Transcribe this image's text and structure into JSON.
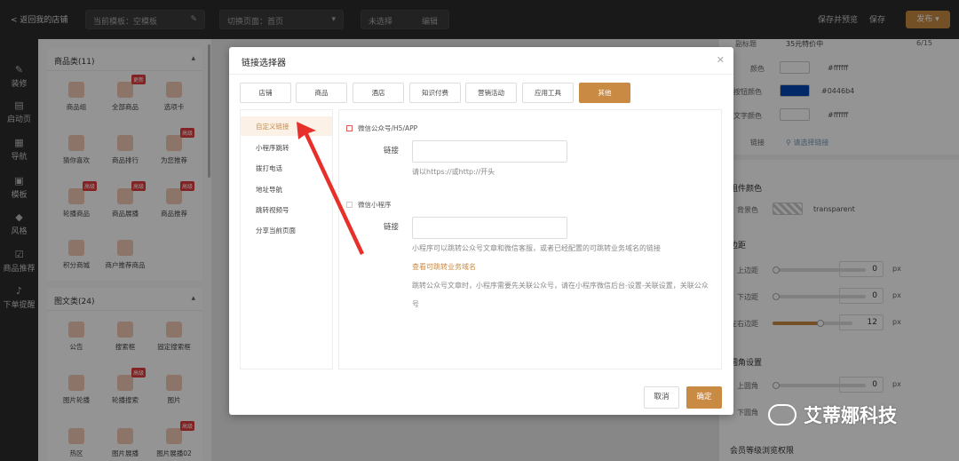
{
  "topbar": {
    "back": "< 返回我的店铺",
    "template": "当前模板：空模板",
    "page": "切换页面：首页",
    "unselected": "未选择",
    "edit": "编辑",
    "save_preview": "保存并预览",
    "save": "保存",
    "publish": "发布"
  },
  "leftnav": [
    {
      "label": "装修",
      "icon": "paint-icon"
    },
    {
      "label": "启动页",
      "icon": "page-icon"
    },
    {
      "label": "导航",
      "icon": "grid-icon"
    },
    {
      "label": "模板",
      "icon": "template-icon"
    },
    {
      "label": "风格",
      "icon": "style-icon"
    },
    {
      "label": "商品推荐",
      "icon": "recommend-icon"
    },
    {
      "label": "下单提醒",
      "icon": "bell-icon"
    }
  ],
  "components": {
    "group1_title": "商品类(11)",
    "group1": [
      "商品组",
      "全部商品",
      "选项卡",
      "猜你喜欢",
      "商品排行",
      "为您推荐",
      "轮播商品",
      "商品展播",
      "商品推荐",
      "积分商城",
      "商户推荐商品"
    ],
    "group2_title": "图文类(24)",
    "group2": [
      "公告",
      "搜索框",
      "固定搜索框",
      "图片轮播",
      "轮播搜索",
      "图片",
      "热区",
      "图片展播",
      "图片展播02"
    ],
    "badge": "高级",
    "badge_new": "更新"
  },
  "right_panel": {
    "subtitle_label": "副标题",
    "subtitle_value": "35元特价中",
    "subtitle_count": "6/15",
    "color_label": "颜色",
    "color_value": "#ffffff",
    "btn_color_label": "按钮颜色",
    "btn_color_value": "#0446b4",
    "text_color_label": "文字颜色",
    "text_color_value": "#ffffff",
    "link_label": "链接",
    "link_placeholder": "请选择链接",
    "bg_section": "组件颜色",
    "bg_label": "背景色",
    "bg_value": "transparent",
    "margin_section": "边距",
    "top_margin": "上边距",
    "bottom_margin": "下边距",
    "lr_margin": "左右边距",
    "corner_section": "圆角设置",
    "top_corner": "上圆角",
    "bottom_corner": "下圆角",
    "vip_label": "会员等级浏览权限",
    "val_0": "0",
    "val_12": "12",
    "unit": "px",
    "lr_fraction": 0.6
  },
  "modal": {
    "title": "链接选择器",
    "tabs": [
      "店铺",
      "商品",
      "酒店",
      "知识付费",
      "营销活动",
      "应用工具",
      "其他"
    ],
    "side_items": [
      "自定义链接",
      "小程序跳转",
      "拨打电话",
      "地址导航",
      "跳转视频号",
      "分享当前页面"
    ],
    "section1": "微信公众号/H5/APP",
    "section2": "微信小程序",
    "link_label": "链接",
    "hint1": "请以https://或http://开头",
    "hint2": "小程序可以跳转公众号文章和微信客服，或者已经配置的可跳转业务域名的链接",
    "hint_link": "查看可跳转业务域名",
    "hint3": "跳转公众号文章时，小程序需要先关联公众号，请在小程序微信后台-设置-关联设置，关联公众号",
    "cancel": "取消",
    "ok": "确定"
  },
  "watermark": "艾蒂娜科技",
  "colors": {
    "accent": "#c98a43",
    "button_blue": "#0446b4"
  }
}
